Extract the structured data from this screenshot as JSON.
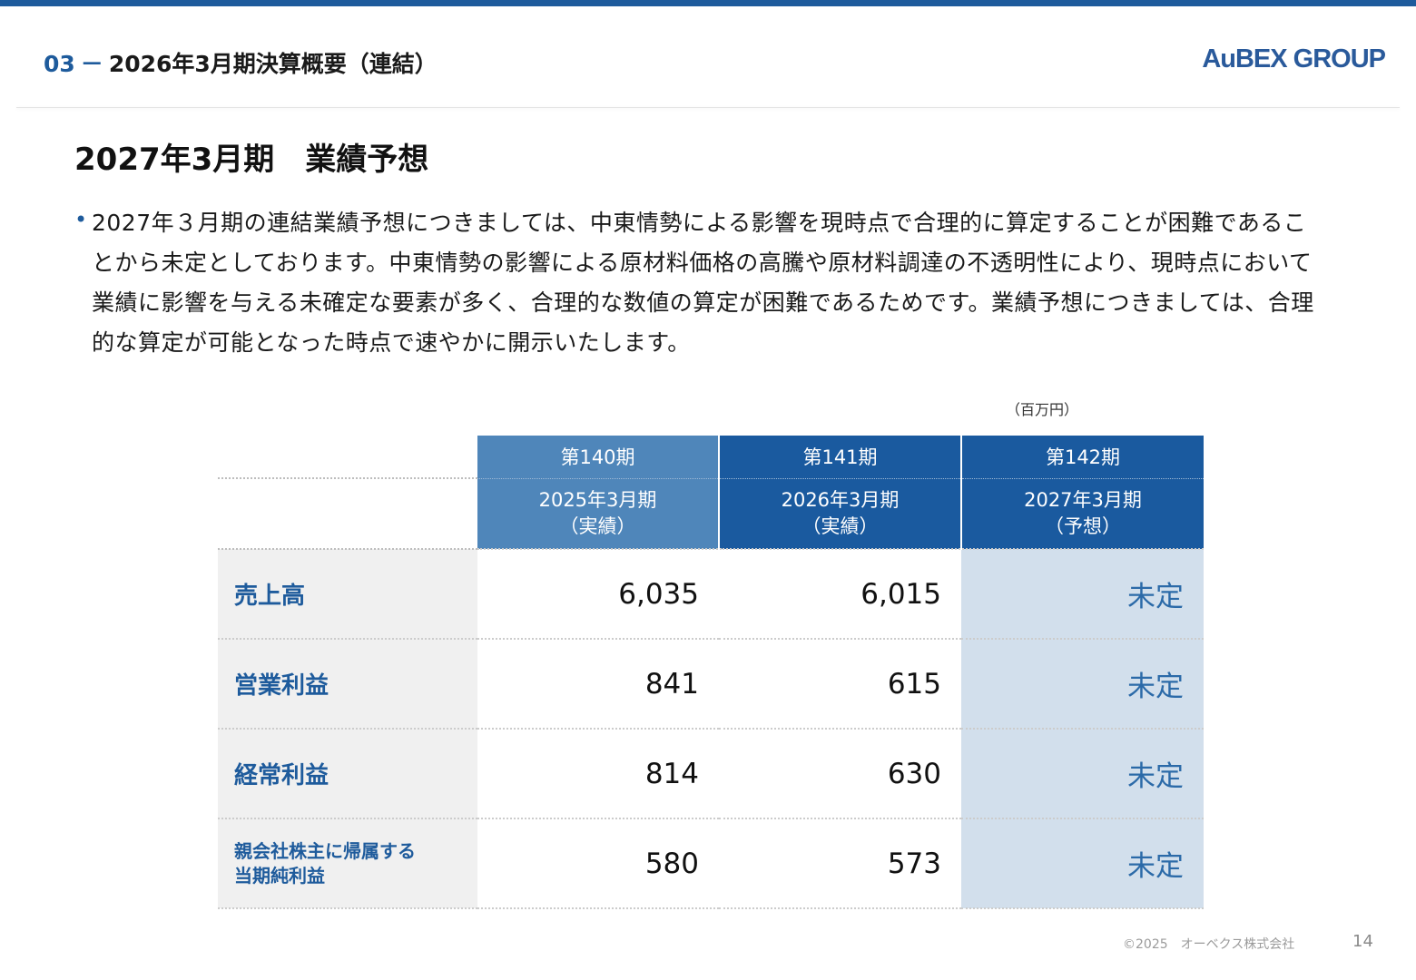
{
  "header": {
    "section_number": "03",
    "section_dash": "－",
    "section_title": "2026年3月期決算概要（連結）",
    "logo_text": "AuBEX GROUP"
  },
  "page_heading": "2027年3月期　業績予想",
  "bullet_text": "2027年３月期の連結業績予想につきましては、中東情勢による影響を現時点で合理的に算定することが困難であることから未定としております。中東情勢の影響による原材料価格の高騰や原材料調達の不透明性により、現時点において業績に影響を与える未確定な要素が多く、合理的な数値の算定が困難であるためです。業績予想につきましては、合理的な算定が可能となった時点で速やかに開示いたします。",
  "unit_label": "（百万円）",
  "table": {
    "periods": [
      {
        "term": "第140期",
        "fiscal": "2025年3月期",
        "kind": "（実績）"
      },
      {
        "term": "第141期",
        "fiscal": "2026年3月期",
        "kind": "（実績）"
      },
      {
        "term": "第142期",
        "fiscal": "2027年3月期",
        "kind": "（予想）"
      }
    ],
    "rows": [
      {
        "label": "売上高",
        "fy2025": "6,035",
        "fy2026": "6,015",
        "fy2027": "未定"
      },
      {
        "label": "営業利益",
        "fy2025": "841",
        "fy2026": "615",
        "fy2027": "未定"
      },
      {
        "label": "経常利益",
        "fy2025": "814",
        "fy2026": "630",
        "fy2027": "未定"
      },
      {
        "label_line1": "親会社株主に帰属する",
        "label_line2": "当期純利益",
        "fy2025": "580",
        "fy2026": "573",
        "fy2027": "未定"
      }
    ]
  },
  "footer": {
    "copyright": "©2025　オーベクス株式会社",
    "page_number": "14"
  },
  "colors": {
    "brand_blue": "#1e5b9c",
    "header_actual_140": "#4f86ba",
    "header_dark": "#1a5a9f",
    "forecast_bg": "#d2dfec",
    "label_bg": "#f0f0f0"
  }
}
